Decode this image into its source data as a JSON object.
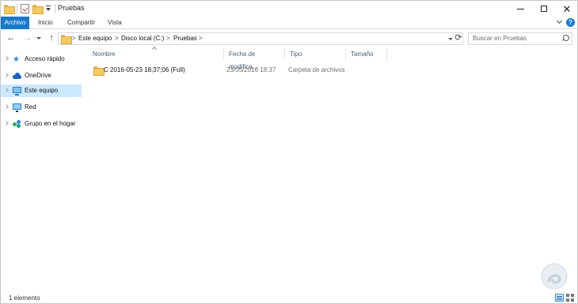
{
  "window": {
    "title": "Pruebas",
    "controls": {
      "minimize": "—",
      "maximize": "☐",
      "close": "✕"
    }
  },
  "ribbon": {
    "tabs": [
      {
        "label": "Archivo",
        "active": true
      },
      {
        "label": "Inicio"
      },
      {
        "label": "Compartir"
      },
      {
        "label": "Vista"
      }
    ],
    "help": "?"
  },
  "nav": {
    "back": "←",
    "forward": "→",
    "up": "↑",
    "refresh": "⟳",
    "breadcrumb": [
      "Este equipo",
      "Disco local (C:)",
      "Pruebas"
    ],
    "separator": ">",
    "search_placeholder": "Buscar en Pruebas"
  },
  "sidebar": {
    "items": [
      {
        "label": "Acceso rápido",
        "icon": "star-icon"
      },
      {
        "label": "OneDrive",
        "icon": "cloud-icon"
      },
      {
        "label": "Este equipo",
        "icon": "computer-icon",
        "selected": true
      },
      {
        "label": "Red",
        "icon": "network-icon"
      },
      {
        "label": "Grupo en el hogar",
        "icon": "homegroup-icon"
      }
    ]
  },
  "table": {
    "columns": [
      "Nombre",
      "Fecha de modifica...",
      "Tipo",
      "Tamaño"
    ],
    "rows": [
      {
        "name": "C 2016-05-23 18;37;06 (Full)",
        "date": "23/05/2016 18:37",
        "type": "Carpeta de archivos",
        "size": "",
        "icon": "folder-icon"
      }
    ]
  },
  "status": {
    "count": "1 elemento"
  },
  "colors": {
    "accent": "#1979ca",
    "selected": "#cce8ff",
    "folder": "#f4c95d"
  }
}
